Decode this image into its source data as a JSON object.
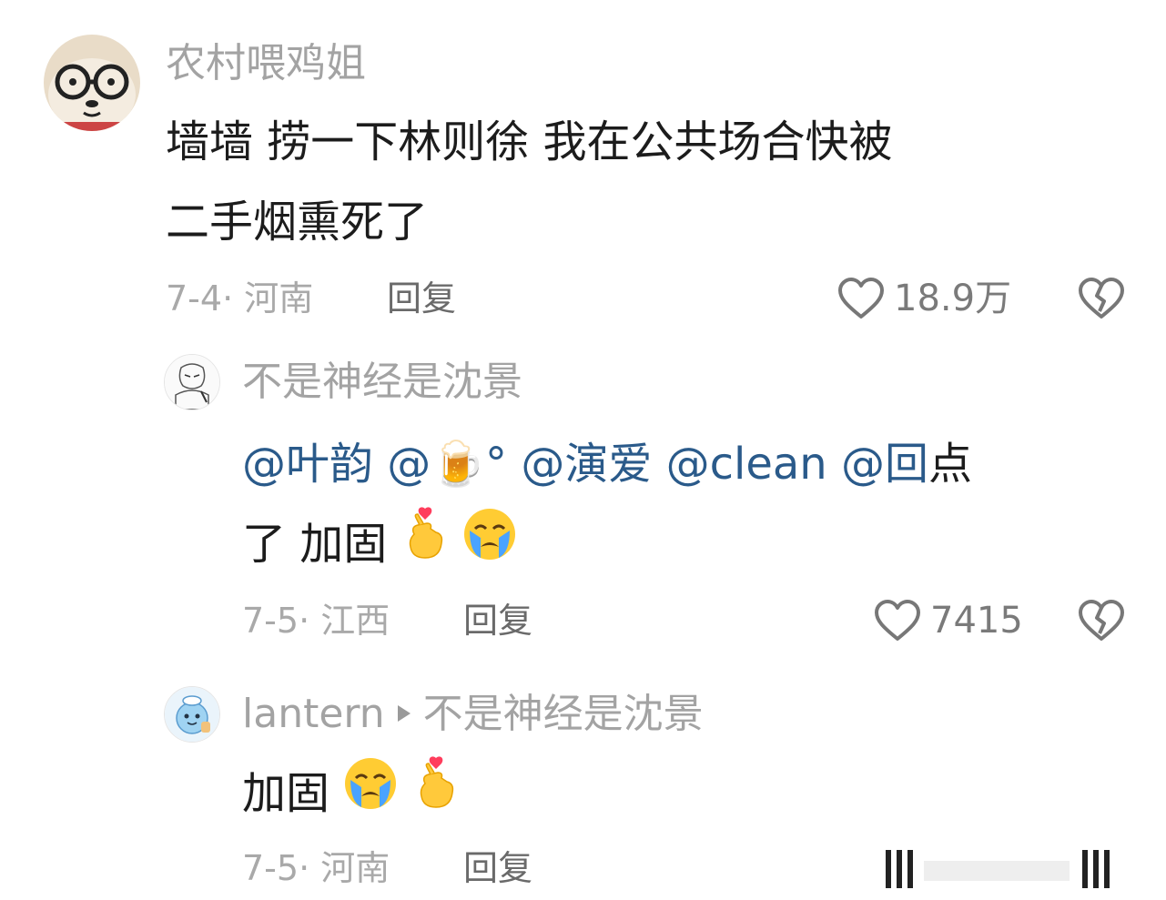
{
  "comments": [
    {
      "username": "农村喂鸡姐",
      "content": [
        "墙墙 捞一下林则徐 我在公共场合快被",
        "二手烟熏死了"
      ],
      "date_location": "7-4· 河南",
      "reply_label": "回复",
      "likes": "18.9万"
    },
    {
      "username": "不是神经是沈景",
      "mentions": [
        "@叶韵",
        "@🍺°",
        "@演爱",
        "@clean",
        "@回"
      ],
      "content_tail_1": "点",
      "content_line2": "了 加固",
      "date_location": "7-5· 江西",
      "reply_label": "回复",
      "likes": "7415"
    },
    {
      "username": "lantern",
      "reply_to": "不是神经是沈景",
      "content": "加固",
      "date_location": "7-5· 河南",
      "reply_label": "回复"
    }
  ],
  "icons": {
    "like": "heart-outline-icon",
    "dislike": "broken-heart-icon",
    "emoji_heart_hand": "finger-heart-emoji",
    "emoji_cry": "loudly-crying-emoji"
  },
  "colors": {
    "mention": "#2a5a8a",
    "username": "#a3a3a3",
    "meta": "#a9a9a9"
  }
}
